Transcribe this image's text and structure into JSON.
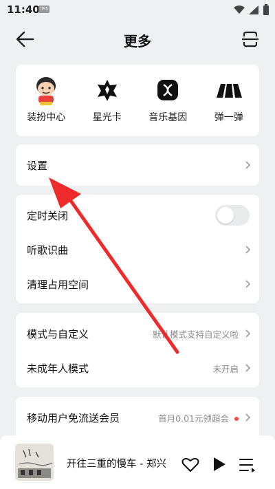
{
  "status_bar": {
    "time": "11:40",
    "badge": "HMS"
  },
  "header": {
    "title": "更多"
  },
  "quick_actions": [
    {
      "label": "装扮中心",
      "icon": "avatar-icon"
    },
    {
      "label": "星光卡",
      "icon": "star-card-icon"
    },
    {
      "label": "音乐基因",
      "icon": "music-gene-icon"
    },
    {
      "label": "弹一弹",
      "icon": "piano-icon"
    }
  ],
  "settings": {
    "label": "设置"
  },
  "group_tools": [
    {
      "label": "定时关闭",
      "toggle": false
    },
    {
      "label": "听歌识曲"
    },
    {
      "label": "清理占用空间"
    }
  ],
  "group_modes": [
    {
      "label": "模式与自定义",
      "value": "默认模式支持自定义啦"
    },
    {
      "label": "未成年人模式",
      "value": "未开启"
    }
  ],
  "group_vip": [
    {
      "label": "移动用户免流送会员",
      "value": "首月0.01元领超会"
    }
  ],
  "player": {
    "song": "开往三重的慢车 - 郑兴"
  },
  "colors": {
    "accent_red": "#ff4a4a",
    "annotation_arrow": "#ef2a2a"
  }
}
